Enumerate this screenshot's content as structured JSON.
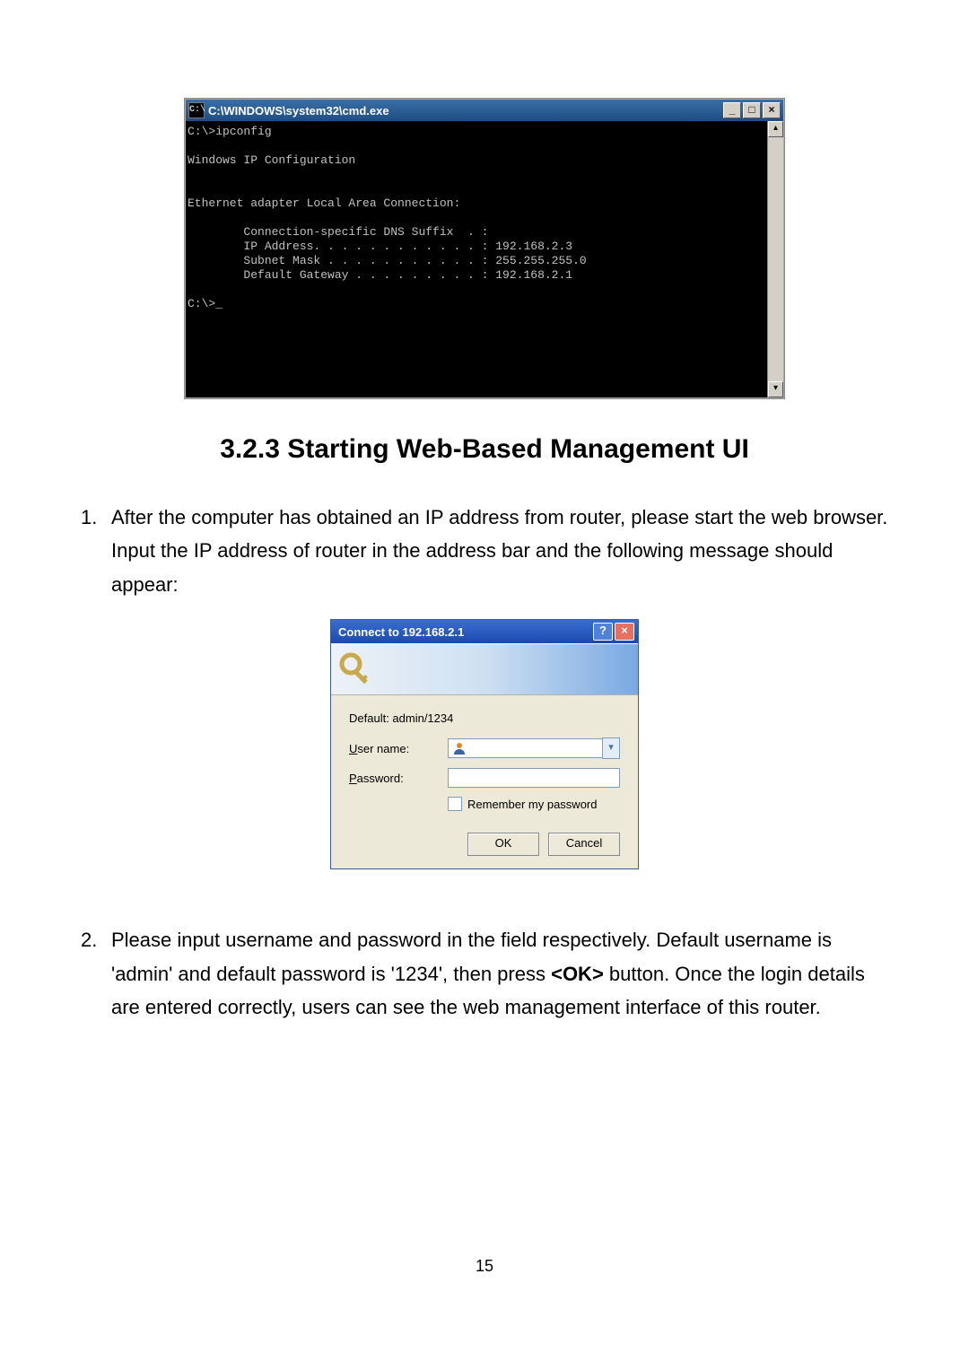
{
  "cmd": {
    "title": "C:\\WINDOWS\\system32\\cmd.exe",
    "min": "_",
    "max": "□",
    "close": "×",
    "output": "C:\\>ipconfig\n\nWindows IP Configuration\n\n\nEthernet adapter Local Area Connection:\n\n        Connection-specific DNS Suffix  . :\n        IP Address. . . . . . . . . . . . : 192.168.2.3\n        Subnet Mask . . . . . . . . . . . : 255.255.255.0\n        Default Gateway . . . . . . . . . : 192.168.2.1\n\nC:\\>_"
  },
  "heading": "3.2.3  Starting Web-Based Management UI",
  "step1": {
    "num": "1.",
    "text": "After the computer has obtained an IP address from router, please start the web browser. Input the IP address of router in the address bar and the following message should appear:"
  },
  "login": {
    "title": "Connect to 192.168.2.1",
    "help": "?",
    "close": "×",
    "realm": "Default: admin/1234",
    "user_label_pre": "U",
    "user_label_post": "ser name:",
    "pass_label_pre": "P",
    "pass_label_post": "assword:",
    "remember_pre": "R",
    "remember_post": "emember my password",
    "ok": "OK",
    "cancel": "Cancel",
    "combo_arrow": "▾"
  },
  "step2": {
    "num": "2.",
    "text_a": "Please input username and password in the field respectively. Default username is 'admin' and default password is '1234', then press ",
    "text_bold": "<OK>",
    "text_b": " button. Once the login details are entered correctly, users can see the web management interface of this router."
  },
  "page_number": "15"
}
